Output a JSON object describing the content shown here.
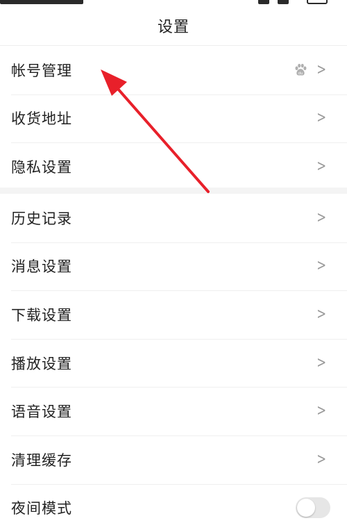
{
  "header": {
    "title": "设置"
  },
  "group1": [
    {
      "label": "帐号管理",
      "icon": "baidu-paw-icon",
      "has_chevron": true
    },
    {
      "label": "收货地址",
      "has_chevron": true
    },
    {
      "label": "隐私设置",
      "has_chevron": true
    }
  ],
  "group2": [
    {
      "label": "历史记录",
      "has_chevron": true
    },
    {
      "label": "消息设置",
      "has_chevron": true
    },
    {
      "label": "下载设置",
      "has_chevron": true
    },
    {
      "label": "播放设置",
      "has_chevron": true
    },
    {
      "label": "语音设置",
      "has_chevron": true
    },
    {
      "label": "清理缓存",
      "has_chevron": true
    },
    {
      "label": "夜间模式",
      "toggle": false
    }
  ],
  "chevron_glyph": ">",
  "colors": {
    "annotation_arrow": "#e8202a",
    "toggle_off": "#e6e6e6",
    "divider": "#efefef"
  }
}
